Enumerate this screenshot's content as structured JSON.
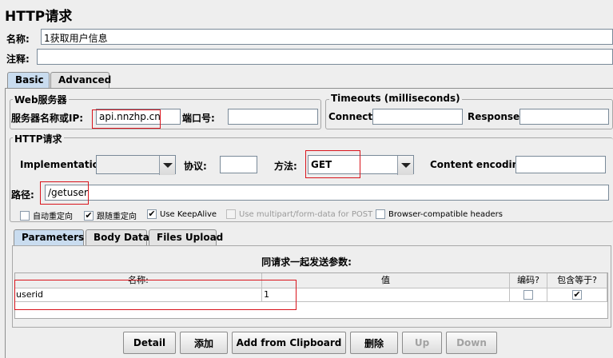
{
  "title": "HTTP请求",
  "name_label": "名称:",
  "name_value": "1获取用户信息",
  "comment_label": "注释:",
  "comment_value": "",
  "tabs": [
    {
      "label": "Basic",
      "selected": true
    },
    {
      "label": "Advanced",
      "selected": false
    }
  ],
  "web_server": {
    "legend": "Web服务器",
    "server_label": "服务器名称或IP:",
    "server_value": "api.nnzhp.cn",
    "port_label": "端口号:",
    "port_value": ""
  },
  "timeouts": {
    "legend": "Timeouts (milliseconds)",
    "connect_label": "Connect:",
    "connect_value": "",
    "response_label": "Response:",
    "response_value": ""
  },
  "http_request": {
    "legend": "HTTP请求",
    "implementation_label": "Implementation:",
    "implementation_value": "",
    "protocol_label": "协议:",
    "protocol_value": "",
    "method_label": "方法:",
    "method_value": "GET",
    "encoding_label": "Content encoding:",
    "encoding_value": "",
    "path_label": "路径:",
    "path_value": "/getuser"
  },
  "options": [
    {
      "label": "自动重定向",
      "checked": false,
      "enabled": true
    },
    {
      "label": "跟随重定向",
      "checked": true,
      "enabled": true
    },
    {
      "label": "Use KeepAlive",
      "checked": true,
      "enabled": true
    },
    {
      "label": "Use multipart/form-data for POST",
      "checked": false,
      "enabled": false
    },
    {
      "label": "Browser-compatible headers",
      "checked": false,
      "enabled": true
    }
  ],
  "param_tabs": [
    {
      "label": "Parameters",
      "selected": true
    },
    {
      "label": "Body Data",
      "selected": false
    },
    {
      "label": "Files Upload",
      "selected": false
    }
  ],
  "params": {
    "heading": "同请求一起发送参数:",
    "columns": [
      "名称:",
      "值",
      "编码?",
      "包含等于?"
    ],
    "rows": [
      {
        "name": "userid",
        "value": "1",
        "encode": false,
        "include_equals": true
      }
    ]
  },
  "buttons": {
    "detail": "Detail",
    "add": "添加",
    "add_clipboard": "Add from Clipboard",
    "delete": "删除",
    "up": "Up",
    "down": "Down"
  },
  "colors": {
    "highlight_box": "#d9141c",
    "selected_tab": "#c9dcef",
    "background": "#eeeeee"
  }
}
